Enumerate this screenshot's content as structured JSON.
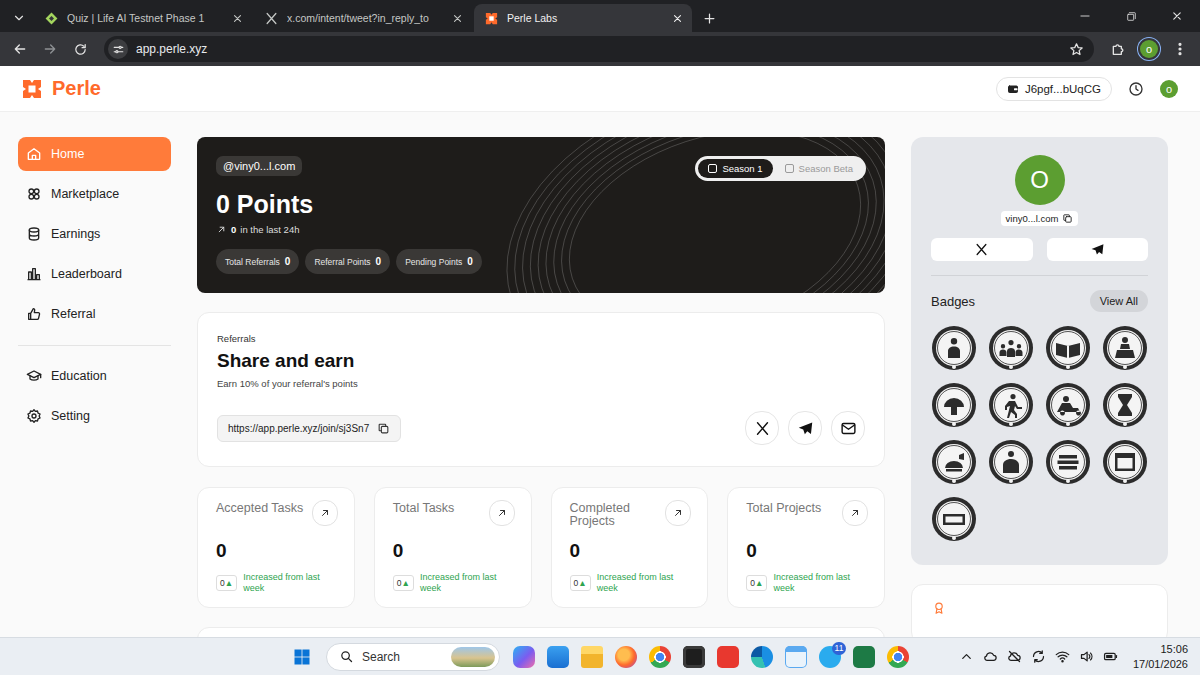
{
  "browser": {
    "tabs": [
      {
        "label": "Quiz | Life AI Testnet Phase 1",
        "selected": false,
        "kind": "quiz"
      },
      {
        "label": "x.com/intent/tweet?in_reply_to",
        "selected": false,
        "kind": "x"
      },
      {
        "label": "Perle Labs",
        "selected": true,
        "kind": "perle"
      }
    ],
    "url": "app.perle.xyz",
    "profile": "o"
  },
  "header": {
    "logo": "Perle",
    "wallet": "J6pgf...bUqCG",
    "avatar": "o"
  },
  "sidebar": {
    "items": [
      {
        "label": "Home",
        "selected": true,
        "kind": "home"
      },
      {
        "label": "Marketplace",
        "selected": false,
        "kind": "marketplace"
      },
      {
        "label": "Earnings",
        "selected": false,
        "kind": "earnings"
      },
      {
        "label": "Leaderboard",
        "selected": false,
        "kind": "leaderboard"
      },
      {
        "label": "Referral",
        "selected": false,
        "kind": "referral"
      }
    ],
    "footer_items": [
      {
        "label": "Education",
        "selected": false,
        "kind": "education"
      },
      {
        "label": "Setting",
        "selected": false,
        "kind": "setting"
      }
    ]
  },
  "hero": {
    "handle": "@viny0...l.com",
    "points": "0 Points",
    "delta": "0",
    "delta_label": "in the last 24h",
    "chips": [
      {
        "label": "Total Referrals",
        "value": "0"
      },
      {
        "label": "Referral Points",
        "value": "0"
      },
      {
        "label": "Pending Points",
        "value": "0"
      }
    ],
    "seasons": [
      {
        "label": "Season 1",
        "selected": true
      },
      {
        "label": "Season Beta",
        "selected": false
      }
    ]
  },
  "referral": {
    "eyebrow": "Referrals",
    "title": "Share and earn",
    "subtitle": "Earn 10% of your referral's points",
    "link": "https://app.perle.xyz/join/sj3Sn7",
    "share": [
      {
        "kind": "x"
      },
      {
        "kind": "telegram"
      },
      {
        "kind": "mail"
      }
    ]
  },
  "stats": [
    {
      "label": "Accepted Tasks",
      "value": "0",
      "change": "0",
      "trend": "▲",
      "note": "Increased from last week"
    },
    {
      "label": "Total Tasks",
      "value": "0",
      "change": "0",
      "trend": "▲",
      "note": "Increased from last week"
    },
    {
      "label": "Completed Projects",
      "value": "0",
      "change": "0",
      "trend": "▲",
      "note": "Increased from last week"
    },
    {
      "label": "Total Projects",
      "value": "0",
      "change": "0",
      "trend": "▲",
      "note": "Increased from last week"
    }
  ],
  "profile": {
    "avatar": "O",
    "name": "viny0...l.com",
    "socials": [
      {
        "kind": "x"
      },
      {
        "kind": "telegram"
      }
    ],
    "badges_title": "Badges",
    "view_all": "View All",
    "badges": [
      {
        "kind": "novice"
      },
      {
        "kind": "researcher"
      },
      {
        "kind": "scholar"
      },
      {
        "kind": "professor"
      },
      {
        "kind": "mastermind"
      },
      {
        "kind": "trailblazer"
      },
      {
        "kind": "speed"
      },
      {
        "kind": "marathon"
      },
      {
        "kind": "hunter"
      },
      {
        "kind": "guardian"
      },
      {
        "kind": "stack"
      },
      {
        "kind": "calendar"
      },
      {
        "kind": "hundred"
      }
    ]
  },
  "taskbar": {
    "search": "Search",
    "apps": [
      {
        "kind": "copilot"
      },
      {
        "kind": "store"
      },
      {
        "kind": "explorer"
      },
      {
        "kind": "firefox"
      },
      {
        "kind": "chrome"
      },
      {
        "kind": "terminal"
      },
      {
        "kind": "wps"
      },
      {
        "kind": "edge"
      },
      {
        "kind": "notepad"
      },
      {
        "kind": "telegram",
        "badge": "11"
      },
      {
        "kind": "excel"
      },
      {
        "kind": "chrome"
      }
    ],
    "tray": [
      {
        "kind": "chevron-up"
      },
      {
        "kind": "cloud"
      },
      {
        "kind": "network"
      },
      {
        "kind": "sync"
      },
      {
        "kind": "wifi"
      },
      {
        "kind": "volume"
      },
      {
        "kind": "battery"
      }
    ],
    "time": "15:06",
    "date": "17/01/2026"
  }
}
